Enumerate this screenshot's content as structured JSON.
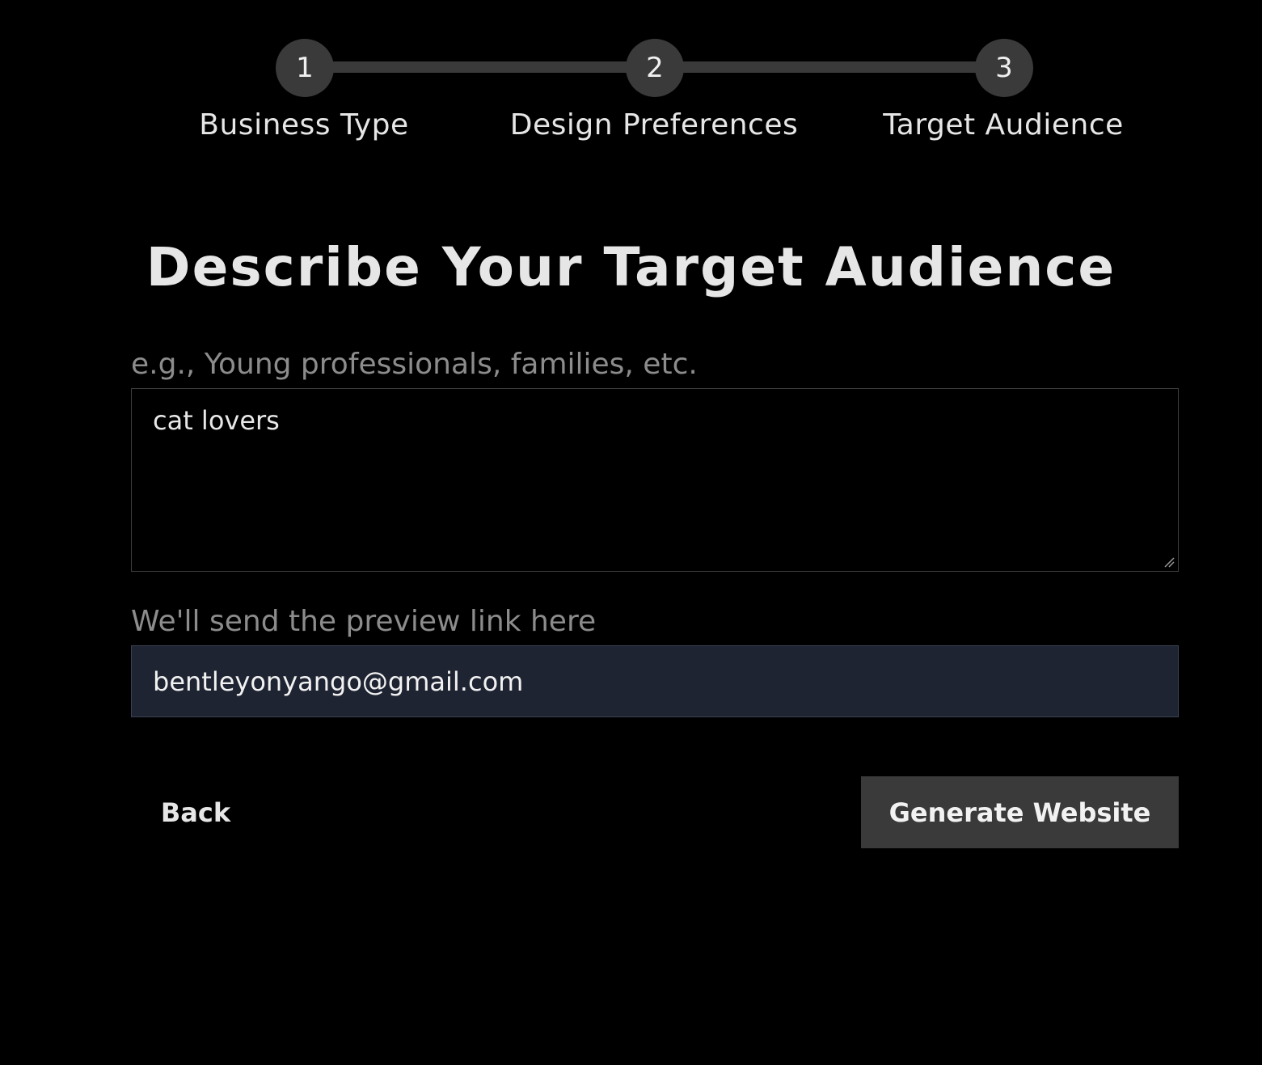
{
  "stepper": {
    "steps": [
      {
        "number": "1",
        "label": "Business Type"
      },
      {
        "number": "2",
        "label": "Design Preferences"
      },
      {
        "number": "3",
        "label": "Target Audience"
      }
    ]
  },
  "main": {
    "title": "Describe Your Target Audience",
    "audience_field": {
      "label": "e.g., Young professionals, families, etc.",
      "value": "cat lovers"
    },
    "email_field": {
      "label": "We'll send the preview link here",
      "value": "bentleyonyango@gmail.com"
    }
  },
  "actions": {
    "back_label": "Back",
    "generate_label": "Generate Website"
  },
  "colors": {
    "background": "#000000",
    "step_fill": "#3a3a3a",
    "input_fill": "#1f2432",
    "button_fill": "#3a3a3a",
    "muted_text": "#8c8c8c"
  }
}
